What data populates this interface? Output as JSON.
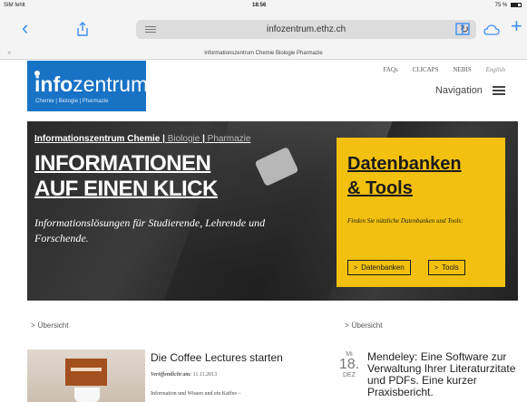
{
  "status_bar": {
    "carrier": "SIM fehlt",
    "time": "18:56",
    "battery": "75 %"
  },
  "browser": {
    "url": "infozentrum.ethz.ch",
    "tab_title": "Informationszentrum Chemie Biologie Pharmazie",
    "icons": [
      "back-icon",
      "share-icon",
      "reader-icon",
      "reload-icon",
      "book-icon",
      "cloud-icon",
      "add-icon"
    ]
  },
  "header": {
    "logo_name_bold": "info",
    "logo_name_light": "zentrum",
    "logo_sub": "Chemie | Biologie | Pharmazie",
    "top_links": [
      "FAQs",
      "CLICAPS",
      "NEBIS"
    ],
    "language": "English",
    "navigation": "Navigation"
  },
  "hero": {
    "breadcrumb_main": "Informationszentrum Chemie",
    "breadcrumb_sep": " | ",
    "breadcrumb_bio": "Biologie",
    "breadcrumb_pharma": "Pharmazie",
    "headline_1": "Informationen",
    "headline_2": "auf einen Klick",
    "tagline": "Informationslösungen für Studierende, Lehrende und Forschende.",
    "box_title_1": "Datenbanken",
    "box_title_2": "& Tools",
    "box_desc": "Finden Sie nützliche Datenbanken und Tools:",
    "btn_datenbanken": "Datenbanken",
    "btn_tools": "Tools",
    "colors": {
      "box": "#f2c00f",
      "logo": "#1872c6"
    }
  },
  "sections": {
    "left_overview": "Übersicht",
    "right_overview": "Übersicht"
  },
  "news": [
    {
      "title": "Die Coffee Lectures starten",
      "date_label": "Veröffentlicht am:",
      "date": "11.11.2013",
      "excerpt": "Information und Wissen und ein Kaffee –"
    },
    {
      "dow": "Mi",
      "day": "18.",
      "month": "DEZ",
      "title": "Mendeley: Eine Software zur Verwaltung Ihrer Literaturzitate und PDFs. Eine kurzer Praxisbericht."
    }
  ]
}
